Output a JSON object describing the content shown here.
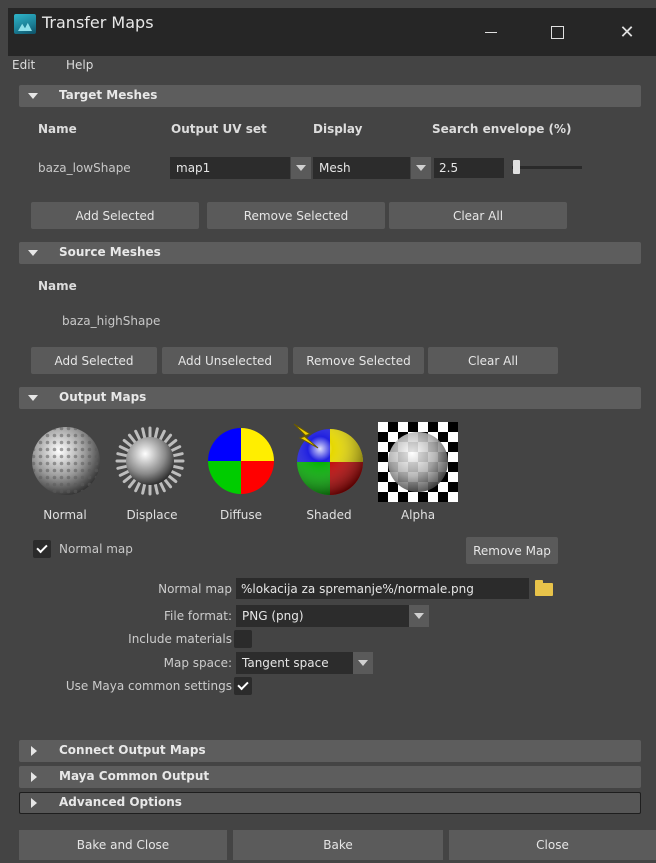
{
  "window": {
    "title": "Transfer Maps",
    "minimize_glyph": "",
    "maximize_glyph": "",
    "close_glyph": "✕"
  },
  "menu": [
    "Edit",
    "Help"
  ],
  "target_meshes": {
    "header": "Target Meshes",
    "columns": [
      "Name",
      "Output UV set",
      "Display",
      "Search envelope (%)"
    ],
    "row": {
      "name": "baza_lowShape",
      "uv_set": "map1",
      "display": "Mesh",
      "envelope": "2.5",
      "envelope_slider_fraction": 0.02
    },
    "buttons": [
      "Add Selected",
      "Remove Selected",
      "Clear All"
    ]
  },
  "source_meshes": {
    "header": "Source Meshes",
    "column": "Name",
    "row": "baza_highShape",
    "buttons": [
      "Add Selected",
      "Add Unselected",
      "Remove Selected",
      "Clear All"
    ]
  },
  "output_maps": {
    "header": "Output Maps",
    "maps": [
      "Normal",
      "Displace",
      "Diffuse",
      "Shaded",
      "Alpha"
    ],
    "normal_map_toggle": "Normal map",
    "normal_map_checked": true,
    "remove_map": "Remove Map",
    "normal_map_label": "Normal map",
    "normal_map_path": "%lokacija za spremanje%/normale.png",
    "file_format_label": "File format:",
    "file_format": "PNG (png)",
    "include_materials_label": "Include materials",
    "include_materials_checked": false,
    "map_space_label": "Map space:",
    "map_space": "Tangent space",
    "use_common_label": "Use Maya common settings",
    "use_common_checked": true
  },
  "collapsed_sections": [
    "Connect Output Maps",
    "Maya Common Output",
    "Advanced Options"
  ],
  "bottom_buttons": [
    "Bake and Close",
    "Bake",
    "Close"
  ],
  "icons": {
    "app": "maya-icon",
    "folder": "folder-icon",
    "checkbox": "checkmark-icon"
  },
  "colors": {
    "accent_folder": "#e8c34a",
    "diffuse_quadrants": [
      "#ffee00",
      "#ff0000",
      "#0000ff",
      "#00cc00"
    ]
  }
}
